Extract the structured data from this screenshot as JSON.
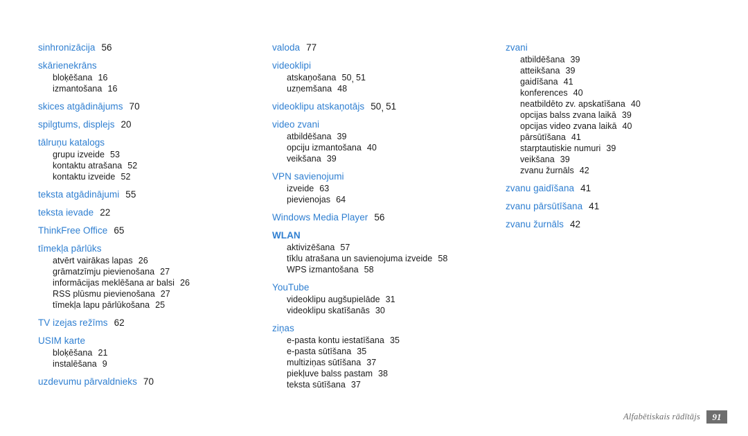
{
  "document": {
    "footer_label": "Alfabētiskais rādītājs",
    "page_number": "91",
    "accent_color": "#2f7fd1",
    "footer_box_color": "#6e6e6e",
    "text_color": "#1a1a1a",
    "background_color": "#ffffff"
  },
  "columns": [
    {
      "id": "column-1",
      "entries": [
        {
          "term": "sinhronizācija",
          "pages": "56",
          "subs": []
        },
        {
          "term": "skārienekrāns",
          "pages": "",
          "subs": [
            {
              "label": "bloķēšana",
              "pages": "16"
            },
            {
              "label": "izmantošana",
              "pages": "16"
            }
          ]
        },
        {
          "term": "skices atgādinājums",
          "pages": "70",
          "subs": []
        },
        {
          "term": "spilgtums, displejs",
          "pages": "20",
          "subs": []
        },
        {
          "term": "tālruņu katalogs",
          "pages": "",
          "subs": [
            {
              "label": "grupu izveide",
              "pages": "53"
            },
            {
              "label": "kontaktu atrašana",
              "pages": "52"
            },
            {
              "label": "kontaktu izveide",
              "pages": "52"
            }
          ]
        },
        {
          "term": "teksta atgādinājumi",
          "pages": "55",
          "subs": []
        },
        {
          "term": "teksta ievade",
          "pages": "22",
          "subs": []
        },
        {
          "term": "ThinkFree Office",
          "pages": "65",
          "subs": []
        },
        {
          "term": "tīmekļa pārlūks",
          "pages": "",
          "subs": [
            {
              "label": "atvērt vairākas lapas",
              "pages": "26"
            },
            {
              "label": "grāmatzīmju pievienošana",
              "pages": "27"
            },
            {
              "label": "informācijas meklēšana ar balsi",
              "pages": "26"
            },
            {
              "label": "RSS plūsmu pievienošana",
              "pages": "27"
            },
            {
              "label": "tīmekļa lapu pārlūkošana",
              "pages": "25"
            }
          ]
        },
        {
          "term": "TV izejas režīms",
          "pages": "62",
          "subs": []
        },
        {
          "term": "USIM karte",
          "pages": "",
          "subs": [
            {
              "label": "bloķēšana",
              "pages": "21"
            },
            {
              "label": "instalēšana",
              "pages": "9"
            }
          ]
        },
        {
          "term": "uzdevumu pārvaldnieks",
          "pages": "70",
          "subs": []
        }
      ]
    },
    {
      "id": "column-2",
      "entries": [
        {
          "term": "valoda",
          "pages": "77",
          "subs": []
        },
        {
          "term": "videoklipi",
          "pages": "",
          "subs": [
            {
              "label": "atskaņošana",
              "pages": "50, 51"
            },
            {
              "label": "uzņemšana",
              "pages": "48"
            }
          ]
        },
        {
          "term": "videoklipu atskaņotājs",
          "pages": "50, 51",
          "subs": []
        },
        {
          "term": "video zvani",
          "pages": "",
          "subs": [
            {
              "label": "atbildēšana",
              "pages": "39"
            },
            {
              "label": "opciju izmantošana",
              "pages": "40"
            },
            {
              "label": "veikšana",
              "pages": "39"
            }
          ]
        },
        {
          "term": "VPN savienojumi",
          "pages": "",
          "subs": [
            {
              "label": "izveide",
              "pages": "63"
            },
            {
              "label": "pievienojas",
              "pages": "64"
            }
          ]
        },
        {
          "term": "Windows Media Player",
          "pages": "56",
          "subs": []
        },
        {
          "term": "WLAN",
          "pages": "",
          "bold": true,
          "subs": [
            {
              "label": "aktivizēšana",
              "pages": "57"
            },
            {
              "label": "tīklu atrašana un savienojuma izveide",
              "pages": "58"
            },
            {
              "label": "WPS izmantošana",
              "pages": "58"
            }
          ]
        },
        {
          "term": "YouTube",
          "pages": "",
          "subs": [
            {
              "label": "videoklipu augšupielāde",
              "pages": "31"
            },
            {
              "label": "videoklipu skatīšanās",
              "pages": "30"
            }
          ]
        },
        {
          "term": "ziņas",
          "pages": "",
          "subs": [
            {
              "label": "e-pasta kontu iestatīšana",
              "pages": "35"
            },
            {
              "label": "e-pasta sūtīšana",
              "pages": "35"
            },
            {
              "label": "multiziņas sūtīšana",
              "pages": "37"
            },
            {
              "label": "piekļuve balss pastam",
              "pages": "38"
            },
            {
              "label": "teksta sūtīšana",
              "pages": "37"
            }
          ]
        }
      ]
    },
    {
      "id": "column-3",
      "entries": [
        {
          "term": "zvani",
          "pages": "",
          "subs": [
            {
              "label": "atbildēšana",
              "pages": "39"
            },
            {
              "label": "atteikšana",
              "pages": "39"
            },
            {
              "label": "gaidīšana",
              "pages": "41"
            },
            {
              "label": "konferences",
              "pages": "40"
            },
            {
              "label": "neatbildēto zv. apskatīšana",
              "pages": "40"
            },
            {
              "label": "opcijas balss zvana laikā",
              "pages": "39"
            },
            {
              "label": "opcijas video zvana laikā",
              "pages": "40"
            },
            {
              "label": "pārsūtīšana",
              "pages": "41"
            },
            {
              "label": "starptautiskie numuri",
              "pages": "39"
            },
            {
              "label": "veikšana",
              "pages": "39"
            },
            {
              "label": "zvanu žurnāls",
              "pages": "42"
            }
          ]
        },
        {
          "term": "zvanu gaidīšana",
          "pages": "41",
          "subs": []
        },
        {
          "term": "zvanu pārsūtīšana",
          "pages": "41",
          "subs": []
        },
        {
          "term": "zvanu žurnāls",
          "pages": "42",
          "subs": []
        }
      ]
    }
  ]
}
